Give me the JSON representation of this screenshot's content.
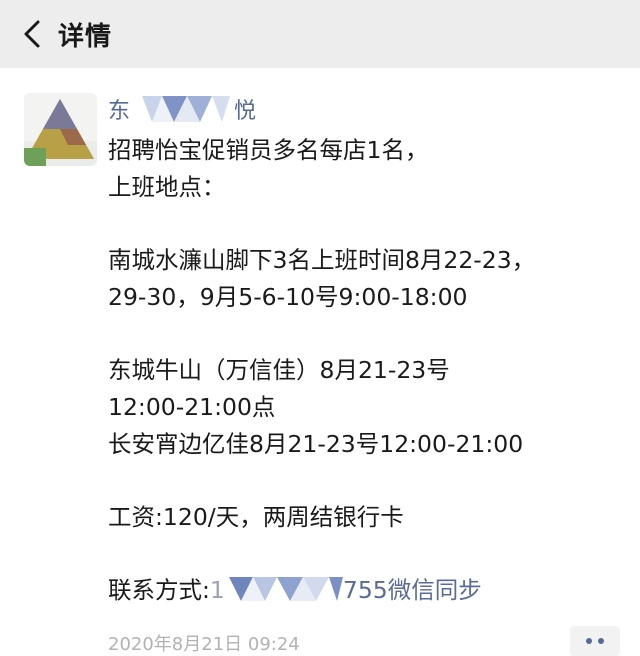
{
  "nav": {
    "title": "详情"
  },
  "post": {
    "nickname_start": "东",
    "nickname_end": "悦",
    "lines": [
      "招聘怡宝促销员多名每店1名，",
      "上班地点：",
      "",
      "南城水濂山脚下3名上班时间8月22-23，",
      "29-30，9月5-6-10号9:00-18:00",
      "",
      "东城牛山（万信佳）8月21-23号",
      "12:00-21:00点",
      "长安宵边亿佳8月21-23号12:00-21:00",
      "",
      "工资:120/天，两周结银行卡"
    ],
    "contact_label": "联系方式:",
    "contact_prefix": "1",
    "contact_suffix": "755微信同步",
    "timestamp": "2020年8月21日 09:24"
  },
  "colors": {
    "nav_bg": "#ededed",
    "nickname": "#576b95",
    "text": "#1a1a1a",
    "timestamp": "#b2b2b2"
  },
  "icons": [
    "back-chevron-icon",
    "more-dots-icon"
  ]
}
